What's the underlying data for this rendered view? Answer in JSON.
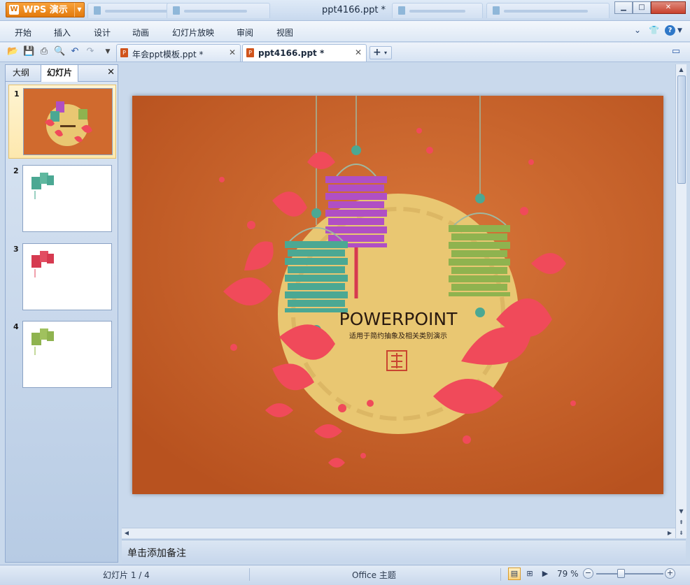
{
  "app": {
    "button_label": "WPS 演示",
    "logo_glyph": "W"
  },
  "window": {
    "title": "ppt4166.ppt *"
  },
  "menu": {
    "items": [
      "开始",
      "插入",
      "设计",
      "动画",
      "幻灯片放映",
      "审阅",
      "视图"
    ]
  },
  "doc_tabs": [
    {
      "label": "年会ppt模板.ppt *",
      "active": false
    },
    {
      "label": "ppt4166.ppt *",
      "active": true
    }
  ],
  "left_panel": {
    "tabs": [
      "大纲",
      "幻灯片"
    ],
    "active_tab": "幻灯片",
    "thumbnails": [
      {
        "num": "1",
        "selected": true
      },
      {
        "num": "2",
        "selected": false
      },
      {
        "num": "3",
        "selected": false
      },
      {
        "num": "4",
        "selected": false
      }
    ]
  },
  "slide": {
    "title": "POWERPOINT",
    "subtitle": "适用于简约抽象及相关类别演示",
    "background_color": "#d06a2e",
    "moon_color": "#e9c772",
    "leaf_color": "#f04a5a",
    "lantern_colors": [
      "#b04fc4",
      "#4ba893",
      "#8fb34f"
    ]
  },
  "notes": {
    "placeholder": "单击添加备注"
  },
  "status": {
    "slide_info": "幻灯片 1 / 4",
    "theme": "Office 主题",
    "zoom": "79 %"
  }
}
